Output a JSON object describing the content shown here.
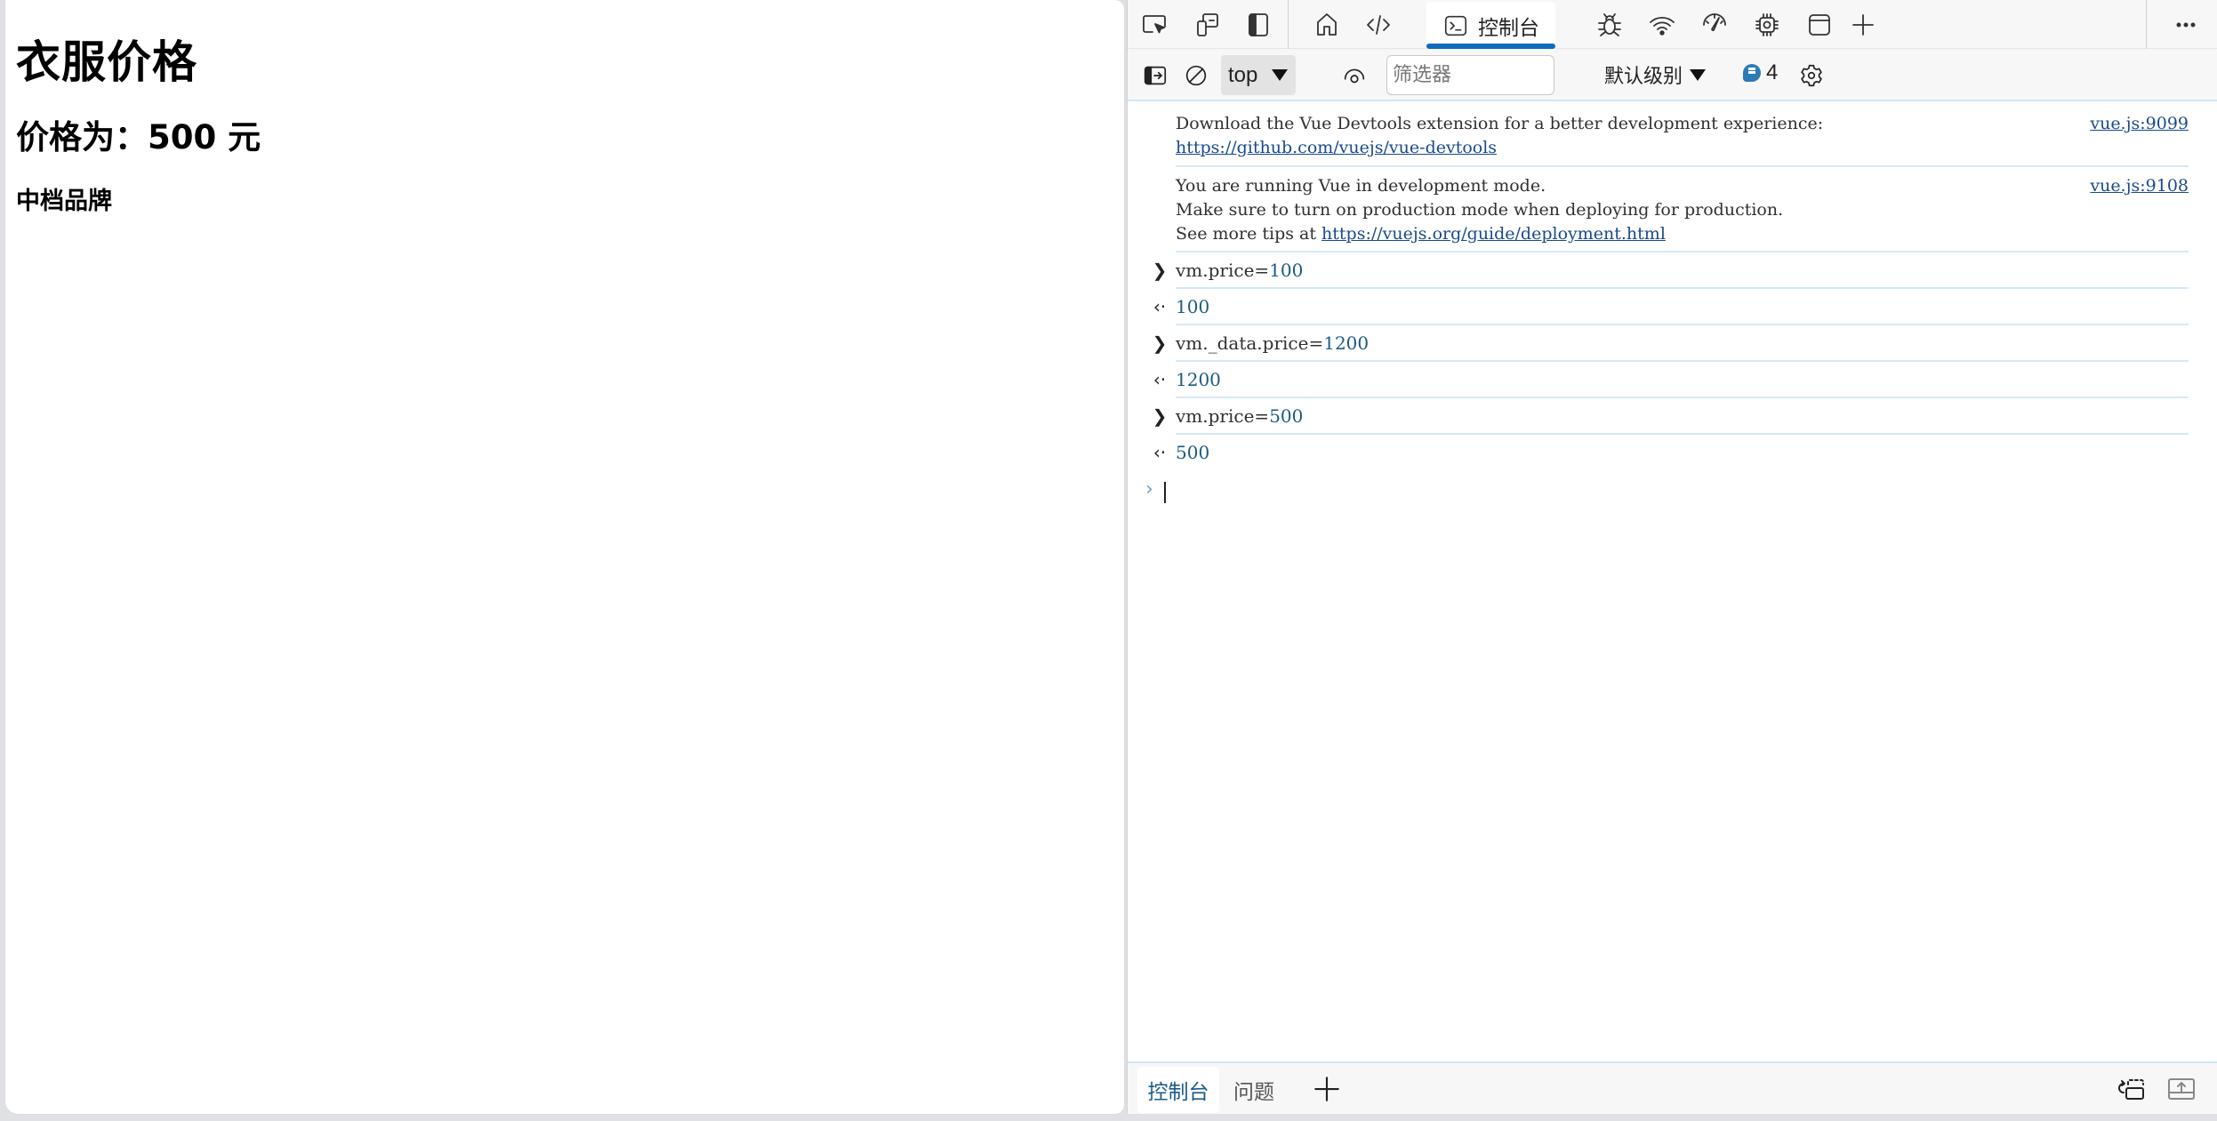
{
  "page": {
    "title": "衣服价格",
    "price_line": "价格为：500 元",
    "brand_level": "中档品牌"
  },
  "devtools": {
    "top_tabs": [
      {
        "name": "inspect",
        "icon": "inspect-element-icon"
      },
      {
        "name": "device",
        "icon": "device-emulation-icon"
      },
      {
        "name": "dock",
        "icon": "dock-side-icon"
      },
      {
        "name": "welcome",
        "icon": "home-icon"
      },
      {
        "name": "elements",
        "icon": "code-icon"
      },
      {
        "name": "console",
        "icon": "console-icon",
        "label": "控制台",
        "active": true
      },
      {
        "name": "sources",
        "icon": "bug-icon"
      },
      {
        "name": "network",
        "icon": "wifi-icon"
      },
      {
        "name": "performance",
        "icon": "gauge-icon"
      },
      {
        "name": "memory",
        "icon": "chip-icon"
      },
      {
        "name": "application",
        "icon": "window-icon"
      },
      {
        "name": "more-tools",
        "icon": "plus-icon"
      }
    ],
    "right_actions": [
      "more-icon",
      "help-icon",
      "close-icon"
    ],
    "console_toolbar": {
      "context": "top",
      "filter_placeholder": "筛选器",
      "filter_value": "",
      "level": "默认级别",
      "message_count": "4"
    },
    "messages": [
      {
        "lines": [
          "Download the Vue Devtools extension for a better development experience:"
        ],
        "link": "https://github.com/vuejs/vue-devtools",
        "source": "vue.js:9099"
      },
      {
        "lines": [
          "You are running Vue in development mode.",
          "Make sure to turn on production mode when deploying for production."
        ],
        "link_prefix": "See more tips at ",
        "link": "https://vuejs.org/guide/deployment.html",
        "source": "vue.js:9108"
      }
    ],
    "history": [
      {
        "type": "input",
        "code": "vm.price=",
        "value": "100"
      },
      {
        "type": "output",
        "value": "100"
      },
      {
        "type": "input",
        "code": "vm._data.price=",
        "value": "1200"
      },
      {
        "type": "output",
        "value": "1200"
      },
      {
        "type": "input",
        "code": "vm.price=",
        "value": "500"
      },
      {
        "type": "output",
        "value": "500"
      }
    ],
    "prompt_value": "",
    "drawer": {
      "tabs": [
        {
          "label": "控制台",
          "active": true
        },
        {
          "label": "问题",
          "active": false
        }
      ]
    },
    "colors": {
      "accent": "#0f6cbd",
      "link": "#1a4a8c",
      "number": "#1c5b85",
      "divider": "#d6e9f7"
    }
  }
}
